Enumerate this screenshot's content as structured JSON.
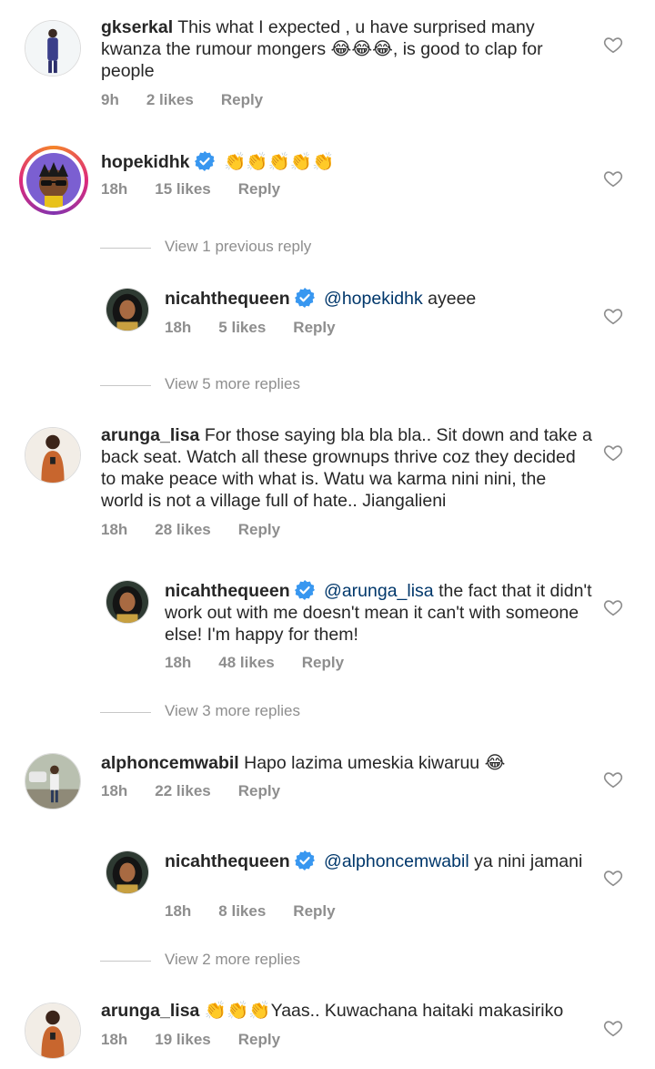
{
  "comments": [
    {
      "username": "gkserkal",
      "body": "This what I expected , u have surprised many kwanza the rumour mongers 😂😂😂, is good to clap for people",
      "time": "9h",
      "likes": "2 likes",
      "reply": "Reply"
    },
    {
      "username": "hopekidhk",
      "body": "👏👏👏👏👏",
      "time": "18h",
      "likes": "15 likes",
      "reply": "Reply"
    },
    {
      "username": "nicahthequeen",
      "mention": "@hopekidhk",
      "body": " ayeee",
      "time": "18h",
      "likes": "5 likes",
      "reply": "Reply"
    },
    {
      "username": "arunga_lisa",
      "body": "For those saying bla bla bla.. Sit down and take a back seat. Watch all these grownups thrive coz they decided to make peace with what is. Watu wa karma nini nini, the world is not a village full of hate.. Jiangalieni",
      "time": "18h",
      "likes": "28 likes",
      "reply": "Reply"
    },
    {
      "username": "nicahthequeen",
      "mention": "@arunga_lisa",
      "body": " the fact that it didn't work out with me doesn't mean it can't with someone else! I'm happy for them!",
      "time": "18h",
      "likes": "48 likes",
      "reply": "Reply"
    },
    {
      "username": "alphoncemwabil",
      "body": "Hapo lazima umeskia kiwaruu 😂",
      "time": "18h",
      "likes": "22 likes",
      "reply": "Reply"
    },
    {
      "username": "nicahthequeen",
      "mention": "@alphoncemwabil",
      "body": " ya nini jamani",
      "time": "18h",
      "likes": "8 likes",
      "reply": "Reply"
    },
    {
      "username": "arunga_lisa",
      "body": "👏👏👏Yaas.. Kuwachana haitaki makasiriko",
      "time": "18h",
      "likes": "19 likes",
      "reply": "Reply"
    }
  ],
  "view_replies": [
    "View 1 previous reply",
    "View 5 more replies",
    "View 3 more replies",
    "View 2 more replies"
  ],
  "colors": {
    "verified": "#3897f0",
    "mention": "#00376b",
    "meta": "#8e8e8e"
  },
  "icons": {
    "like": "heart-outline-icon",
    "verified": "verified-badge-icon"
  }
}
